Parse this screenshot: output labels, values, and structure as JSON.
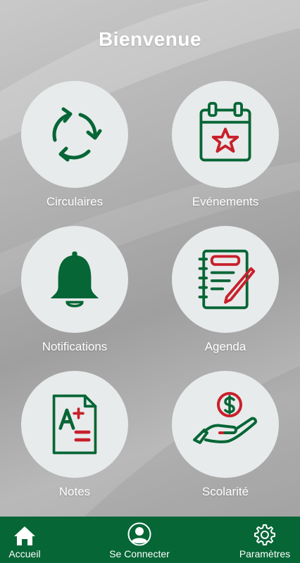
{
  "header": {
    "title": "Bienvenue"
  },
  "tiles": [
    {
      "label": "Circulaires",
      "icon": "recycle-arrows-icon"
    },
    {
      "label": "Evénements",
      "icon": "calendar-star-icon"
    },
    {
      "label": "Notifications",
      "icon": "bell-icon"
    },
    {
      "label": "Agenda",
      "icon": "notebook-pen-icon"
    },
    {
      "label": "Notes",
      "icon": "grade-document-icon"
    },
    {
      "label": "Scolarité",
      "icon": "hand-dollar-icon"
    }
  ],
  "nav": {
    "items": [
      {
        "label": "Accueil",
        "icon": "home-icon"
      },
      {
        "label": "Se Connecter",
        "icon": "user-icon"
      },
      {
        "label": "Paramètres",
        "icon": "gear-icon"
      }
    ]
  },
  "colors": {
    "primary_green": "#066636",
    "accent_red": "#c8202b",
    "tile_bg": "#e8ebeb"
  }
}
